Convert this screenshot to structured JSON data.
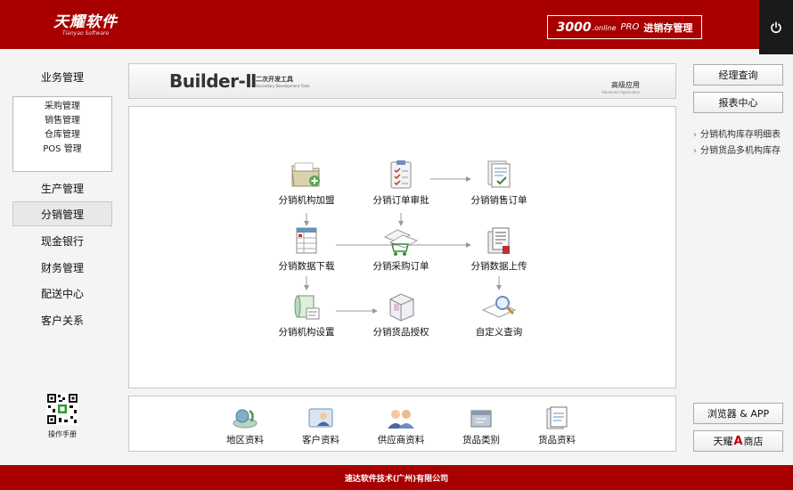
{
  "header": {
    "logo_main": "天耀软件",
    "logo_sub": "Tianyao Software",
    "product_num": "3000",
    "product_online": ".online",
    "product_pro": "PRO",
    "product_name": "进销存管理"
  },
  "nav": {
    "business": "业务管理",
    "sub_items": [
      "采购管理",
      "销售管理",
      "仓库管理",
      "POS 管理"
    ],
    "production": "生产管理",
    "distribution": "分销管理",
    "cash": "现金银行",
    "finance": "财务管理",
    "delivery": "配送中心",
    "customer": "客户关系",
    "manual": "操作手册"
  },
  "banner": {
    "title": "Builder-Ⅱ",
    "cn": "二次开发工具",
    "en": "Secondary Development Tools",
    "adv": "高级应用",
    "adv_en": "Advanced Application"
  },
  "flow": {
    "nodes": [
      {
        "key": "join",
        "label": "分销机构加盟",
        "icon": "folder-plus-icon"
      },
      {
        "key": "review",
        "label": "分销订单审批",
        "icon": "clipboard-check-icon"
      },
      {
        "key": "sales_order",
        "label": "分销销售订单",
        "icon": "document-check-icon"
      },
      {
        "key": "download",
        "label": "分销数据下载",
        "icon": "table-download-icon"
      },
      {
        "key": "purchase",
        "label": "分销采购订单",
        "icon": "cart-documents-icon"
      },
      {
        "key": "upload",
        "label": "分销数据上传",
        "icon": "files-upload-icon"
      },
      {
        "key": "settings",
        "label": "分销机构设置",
        "icon": "scroll-settings-icon"
      },
      {
        "key": "auth",
        "label": "分销货品授权",
        "icon": "product-box-icon"
      },
      {
        "key": "query",
        "label": "自定义查询",
        "icon": "magnifier-query-icon"
      }
    ]
  },
  "bottom": {
    "items": [
      {
        "label": "地区资料",
        "icon": "region-icon"
      },
      {
        "label": "客户资料",
        "icon": "customer-icon"
      },
      {
        "label": "供应商资料",
        "icon": "supplier-icon"
      },
      {
        "label": "货品类别",
        "icon": "product-category-icon"
      },
      {
        "label": "货品资料",
        "icon": "product-data-icon"
      }
    ]
  },
  "right": {
    "manager_query": "经理查询",
    "report_center": "报表中心",
    "links": [
      "分销机构库存明细表",
      "分销货品多机构库存"
    ],
    "browser_app": "浏览器 & APP",
    "store_pre": "天耀",
    "store_a": "A",
    "store_post": "商店"
  },
  "footer": {
    "company": "速达软件技术(广州)有限公司"
  },
  "colors": {
    "brand_red": "#a80000",
    "dark": "#1a1a1a"
  }
}
